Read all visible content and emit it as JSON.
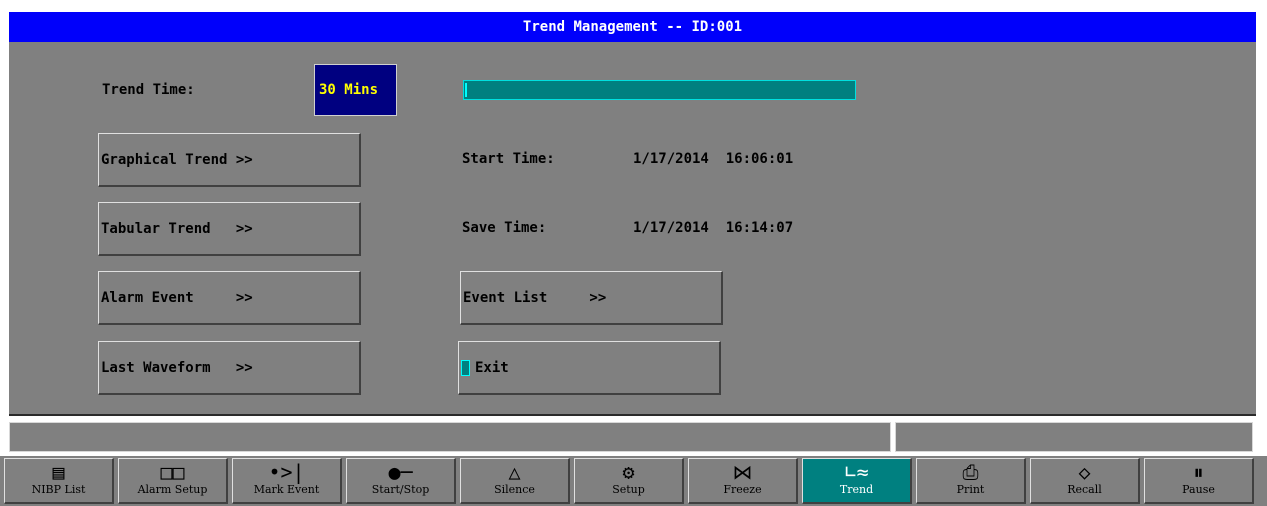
{
  "window": {
    "title": "Trend Management -- ID:001"
  },
  "trend_time": {
    "label": "Trend Time:",
    "value": "30 Mins"
  },
  "buttons": {
    "graphical_trend": "Graphical Trend >>",
    "tabular_trend": "Tabular Trend   >>",
    "alarm_event": "Alarm Event     >>",
    "last_waveform": "Last Waveform   >>",
    "event_list": "Event List     >>",
    "exit": "Exit"
  },
  "times": {
    "start_label": "Start Time:",
    "start_value": "1/17/2014  16:06:01",
    "save_label": "Save Time:",
    "save_value": "1/17/2014  16:14:07"
  },
  "progress": {
    "fraction": 0.0
  },
  "toolbar": [
    {
      "label": "NIBP List",
      "icon": "list-icon"
    },
    {
      "label": "Alarm Setup",
      "icon": "book-icon"
    },
    {
      "label": "Mark Event",
      "icon": "mark-arrow-icon"
    },
    {
      "label": "Start/Stop",
      "icon": "cuff-icon"
    },
    {
      "label": "Silence",
      "icon": "bell-icon"
    },
    {
      "label": "Setup",
      "icon": "gear-icon"
    },
    {
      "label": "Freeze",
      "icon": "freeze-icon"
    },
    {
      "label": "Trend",
      "icon": "trend-icon",
      "active": true
    },
    {
      "label": "Print",
      "icon": "print-icon"
    },
    {
      "label": "Recall",
      "icon": "recall-icon"
    },
    {
      "label": "Pause",
      "icon": "pause-icon"
    }
  ],
  "colors": {
    "title_bg": "#0000fb",
    "panel_bg": "#808080",
    "accent": "#008080",
    "selected_bg": "#000080",
    "selected_text": "#ffff00"
  }
}
